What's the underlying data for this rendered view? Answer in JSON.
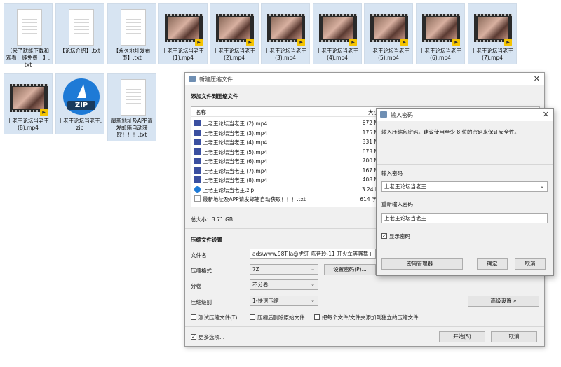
{
  "desktop": {
    "files": [
      {
        "label": "【来了就能下载和观看！纯免费！】.txt",
        "type": "txt"
      },
      {
        "label": "【论坛介绍】.txt",
        "type": "txt"
      },
      {
        "label": "【永久地址发布页】.txt",
        "type": "txt"
      },
      {
        "label": "上老王论坛当老王 (1).mp4",
        "type": "video",
        "badge": "Player"
      },
      {
        "label": "上老王论坛当老王 (2).mp4",
        "type": "video",
        "badge": "Player"
      },
      {
        "label": "上老王论坛当老王 (3).mp4",
        "type": "video",
        "badge": "Player"
      },
      {
        "label": "上老王论坛当老王 (4).mp4",
        "type": "video",
        "badge": "Player"
      },
      {
        "label": "上老王论坛当老王 (5).mp4",
        "type": "video",
        "badge": "Player"
      },
      {
        "label": "上老王论坛当老王 (6).mp4",
        "type": "video",
        "badge": "Player"
      },
      {
        "label": "上老王论坛当老王 (7).mp4",
        "type": "video",
        "badge": "Player"
      },
      {
        "label": "上老王论坛当老王 (8).mp4",
        "type": "video",
        "badge": "Player"
      },
      {
        "label": "上老王论坛当老王.zip",
        "type": "zip",
        "icon_text": "ZIP"
      },
      {
        "label": "最新地址及APP请发邮箱自动获取！！！.txt",
        "type": "txt"
      }
    ]
  },
  "archive_dialog": {
    "title": "新建压缩文件",
    "add_section": "添加文件到压缩文件",
    "col_name": "名称",
    "col_size": "大小",
    "rows": [
      {
        "name": "上老王论坛当老王 (2).mp4",
        "size": "672 MB",
        "icon": "video"
      },
      {
        "name": "上老王论坛当老王 (3).mp4",
        "size": "175 MB",
        "icon": "video"
      },
      {
        "name": "上老王论坛当老王 (4).mp4",
        "size": "331 MB",
        "icon": "video"
      },
      {
        "name": "上老王论坛当老王 (5).mp4",
        "size": "673 MB",
        "icon": "video"
      },
      {
        "name": "上老王论坛当老王 (6).mp4",
        "size": "700 MB",
        "icon": "video"
      },
      {
        "name": "上老王论坛当老王 (7).mp4",
        "size": "167 MB",
        "icon": "video"
      },
      {
        "name": "上老王论坛当老王 (8).mp4",
        "size": "408 MB",
        "icon": "video"
      },
      {
        "name": "上老王论坛当老王.zip",
        "size": "3.24 KB",
        "icon": "zip"
      },
      {
        "name": "最新地址及APP请发邮箱自动获取！！！.txt",
        "size": "614 字节",
        "icon": "txt"
      }
    ],
    "total_size": "总大小：3.71 GB",
    "settings_section": "压缩文件设置",
    "filename_label": "文件名",
    "filename_value": "ads\\www.98T.la@虎牙 陈晋玲-11 开火车等骚舞+",
    "format_label": "压缩格式",
    "format_value": "7Z",
    "set_password_button": "设置密码(P)...",
    "split_label": "分卷",
    "split_value": "不分卷",
    "level_label": "压缩级别",
    "level_value": "1-快速压缩",
    "advanced_button": "高级设置 »",
    "test_checkbox": "测试压缩文件(T)",
    "delete_checkbox": "压缩后删除原始文件",
    "separate_checkbox": "把每个文件/文件夹添加到独立的压缩文件",
    "more_options": "更多选项...",
    "more_options_checked": true,
    "start_button": "开始(S)",
    "cancel_button": "取消"
  },
  "password_dialog": {
    "title": "输入密码",
    "description": "输入压缩包密码。建议使用至少 8 位的密码来保证安全性。",
    "enter_label": "输入密码",
    "enter_value": "上老王论坛当老王",
    "reenter_label": "重新输入密码",
    "reenter_value": "上老王论坛当老王",
    "show_password": "显示密码",
    "show_password_checked": true,
    "manager_button": "密码管理器...",
    "ok_button": "确定",
    "cancel_button": "取消"
  }
}
